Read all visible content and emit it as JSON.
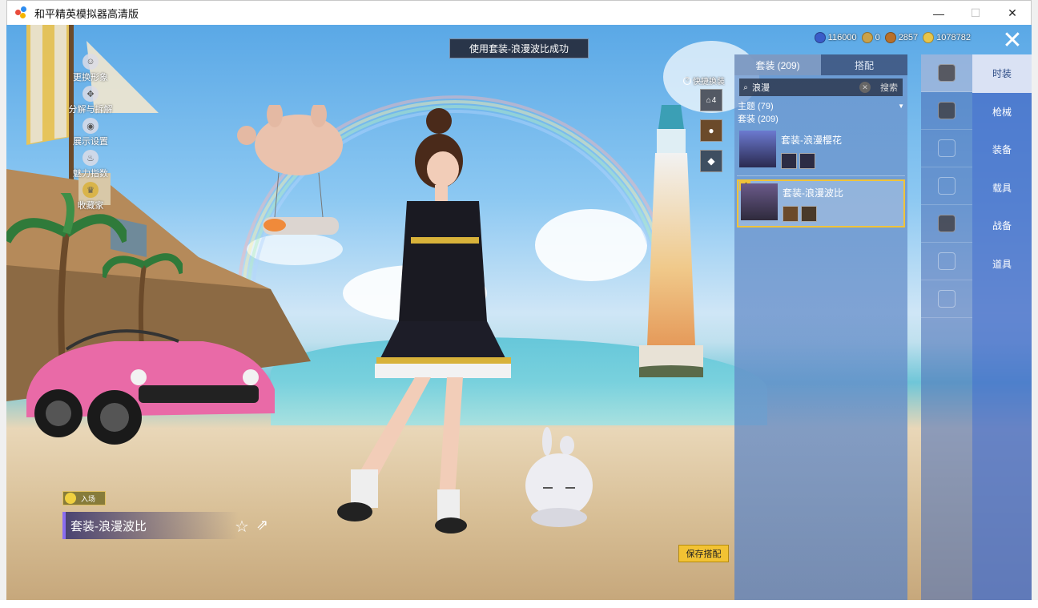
{
  "window": {
    "title": "和平精英模拟器高清版",
    "min_icon": "minimize-icon",
    "max_icon": "maximize-icon",
    "close_icon": "close-icon"
  },
  "left_menu": [
    {
      "label": "更换形象",
      "icon": "avatar-icon"
    },
    {
      "label": "分解与拆解",
      "icon": "dismantle-icon"
    },
    {
      "label": "展示设置",
      "icon": "eye-icon"
    },
    {
      "label": "魅力指数",
      "icon": "charm-icon"
    },
    {
      "label": "收藏家",
      "icon": "collector-icon"
    }
  ],
  "notice": "使用套装-浪漫波比成功",
  "currency": [
    {
      "value": "116000",
      "color": "#3a5cc8"
    },
    {
      "value": "0",
      "color": "#caa24a"
    },
    {
      "value": "2857",
      "color": "#b8702a"
    },
    {
      "value": "1078782",
      "color": "#e8c54a"
    }
  ],
  "quick_swap": {
    "label": "快捷换装",
    "slot1": "4"
  },
  "panel": {
    "tabs": [
      "套装 (209)",
      "搭配"
    ],
    "search_value": "浪漫",
    "search_button": "搜索",
    "theme_filter": "主题 (79)",
    "set_count": "套装 (209)",
    "items": [
      {
        "name": "套装-浪漫樱花",
        "selected": false
      },
      {
        "name": "套装-浪漫波比",
        "selected": true
      }
    ]
  },
  "side_nav": [
    "时装",
    "枪械",
    "装备",
    "载具",
    "战备",
    "道具"
  ],
  "category_icons": [
    "outfit-icon",
    "hat-icon",
    "glasses-icon",
    "mask-icon",
    "top-icon",
    "pants-icon",
    "shoes-icon"
  ],
  "entrance_label": "入场",
  "outfit_name": "套装-浪漫波比",
  "save_button": "保存搭配"
}
